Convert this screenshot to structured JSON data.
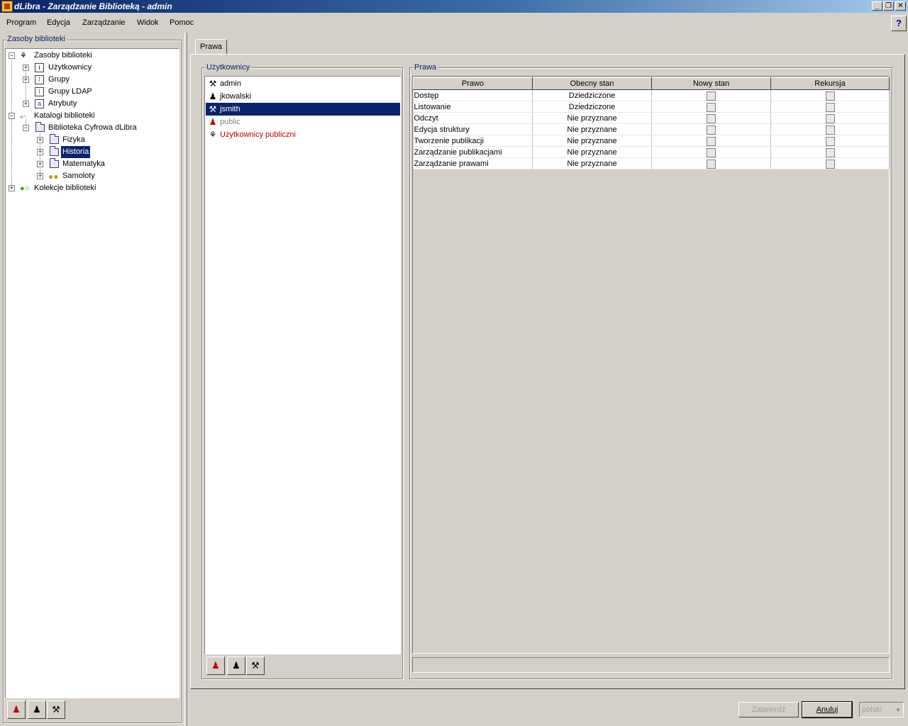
{
  "window": {
    "title": "dLibra - Zarządzanie Biblioteką - admin",
    "minimize": "_",
    "restore": "❐",
    "close": "✕"
  },
  "menu": [
    "Program",
    "Edycja",
    "Zarządzanie",
    "Widok",
    "Pomoc"
  ],
  "help_button": "?",
  "left_panel": {
    "title": "Zasoby biblioteki",
    "tree": [
      {
        "label": "Zasoby biblioteki",
        "icon": "network-icon",
        "expander": "−"
      },
      {
        "label": "Użytkownicy",
        "icon": "users-icon",
        "expander": "+"
      },
      {
        "label": "Grupy",
        "icon": "groups-icon",
        "expander": "+"
      },
      {
        "label": "Grupy LDAP",
        "icon": "ldap-groups-icon",
        "expander": ""
      },
      {
        "label": "Atrybuty",
        "icon": "attributes-icon",
        "expander": "+"
      },
      {
        "label": "Katalogi biblioteki",
        "icon": "catalogs-icon",
        "expander": "−"
      },
      {
        "label": "Biblioteka Cyfrowa dLibra",
        "icon": "folder-icon",
        "expander": "−"
      },
      {
        "label": "Fizyka",
        "icon": "folder-icon",
        "expander": "+"
      },
      {
        "label": "Historia",
        "icon": "folder-icon",
        "expander": "+"
      },
      {
        "label": "Matematyka",
        "icon": "folder-icon",
        "expander": "+"
      },
      {
        "label": "Samoloty",
        "icon": "collection-icon",
        "expander": "+"
      },
      {
        "label": "Kolekcje biblioteki",
        "icon": "collections-icon",
        "expander": "+"
      }
    ]
  },
  "tabs": [
    "Prawa"
  ],
  "users_panel": {
    "title": "Użytkownicy",
    "items": [
      {
        "label": "admin",
        "icon": "admin-user-icon"
      },
      {
        "label": "jkowalski",
        "icon": "user-icon"
      },
      {
        "label": "jsmith",
        "icon": "admin-user-icon"
      },
      {
        "label": "public",
        "icon": "public-user-icon"
      },
      {
        "label": "Użytkownicy publiczni",
        "icon": "public-group-icon"
      }
    ],
    "item_colors": {
      "disabled": "#808080",
      "public_group": "#c00000"
    }
  },
  "rights_panel": {
    "title": "Prawa",
    "columns": [
      "Prawo",
      "Obecny stan",
      "Nowy stan",
      "Rekursja"
    ],
    "rows": [
      {
        "name": "Dostęp",
        "state": "Dziedziczone"
      },
      {
        "name": "Listowanie",
        "state": "Dziedziczone"
      },
      {
        "name": "Odczyt",
        "state": "Nie przyznane"
      },
      {
        "name": "Edycja struktury",
        "state": "Nie przyznane"
      },
      {
        "name": "Tworzenie publikacji",
        "state": "Nie przyznane"
      },
      {
        "name": "Zarządzanie publikacjami",
        "state": "Nie przyznane"
      },
      {
        "name": "Zarządzanie prawami",
        "state": "Nie przyznane"
      }
    ]
  },
  "buttons": {
    "confirm": "Zatwierdź",
    "cancel": "Anuluj",
    "language": "polski"
  },
  "colors": {
    "selection": "#0a246a",
    "group_title": "#0a246a",
    "background": "#d4d0c8"
  }
}
